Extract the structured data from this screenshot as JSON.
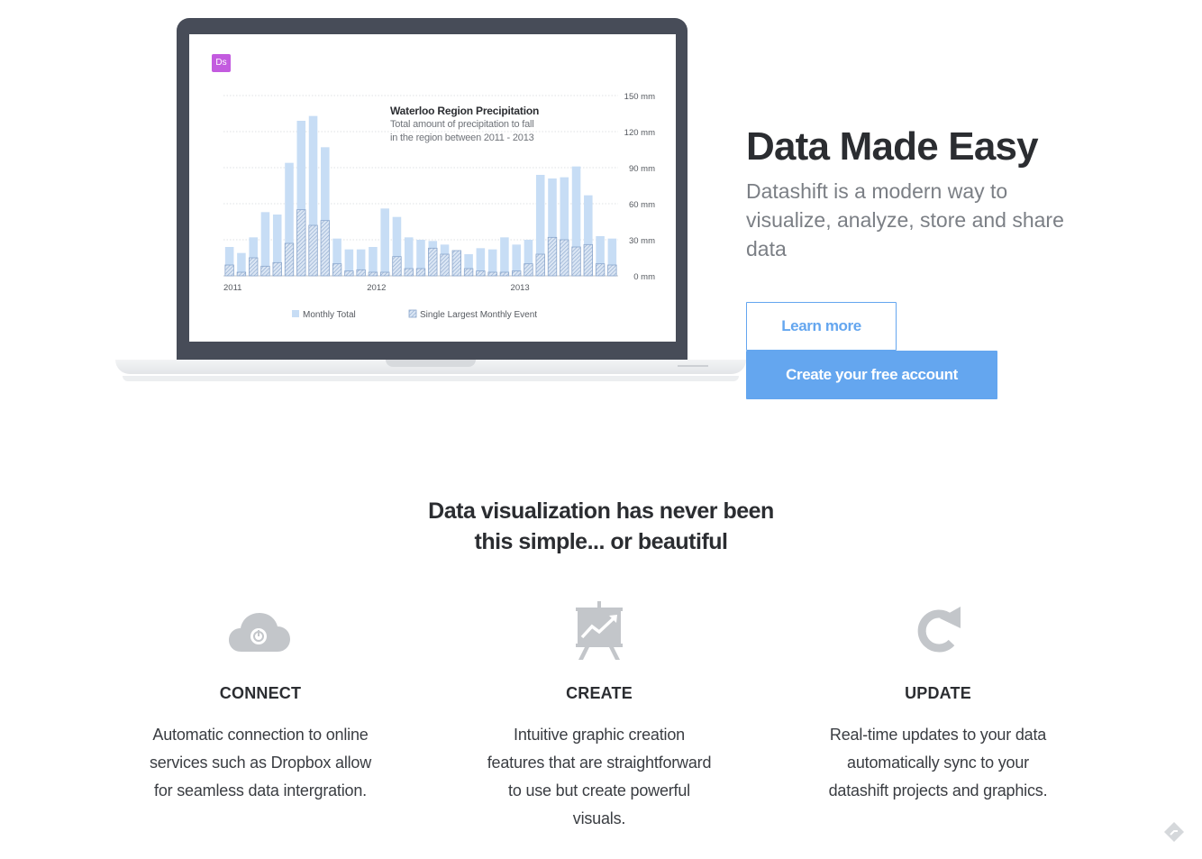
{
  "laptop": {
    "app_badge": "Ds"
  },
  "chart_data": {
    "type": "bar",
    "title": "Waterloo Region Precipitation",
    "subtitle_lines": [
      "Total amount of precipitation to fall",
      "in the region between 2011 - 2013"
    ],
    "x_tick_labels": [
      "2011",
      "2012",
      "2013"
    ],
    "y_tick_labels": [
      "150 mm",
      "120 mm",
      "90 mm",
      "60 mm",
      "30 mm",
      "0 mm"
    ],
    "ylim": [
      0,
      150
    ],
    "grid": true,
    "legend_position": "bottom",
    "colors": {
      "total": "#c7ddf5",
      "largest": "#8aa6cc"
    },
    "series": [
      {
        "name": "Monthly Total",
        "values": [
          24,
          19,
          32,
          53,
          51,
          94,
          129,
          133,
          107,
          31,
          22,
          22,
          24,
          56,
          49,
          32,
          30,
          29,
          26,
          21,
          18,
          23,
          22,
          32,
          26,
          30,
          84,
          81,
          82,
          91,
          67,
          33,
          31
        ]
      },
      {
        "name": "Single Largest Monthly Event",
        "values": [
          9,
          3,
          15,
          8,
          11,
          27,
          55,
          42,
          46,
          10,
          4,
          5,
          3,
          3,
          16,
          6,
          6,
          23,
          18,
          21,
          6,
          4,
          3,
          3,
          4,
          10,
          18,
          32,
          30,
          24,
          26,
          10,
          9
        ]
      }
    ]
  },
  "hero": {
    "title": "Data Made Easy",
    "subtitle": "Datashift is a modern way to visualize, analyze, store and share data",
    "learn_more": "Learn more",
    "create_account": "Create your free account"
  },
  "section": {
    "heading_line1": "Data visualization has never been",
    "heading_line2": "this simple... or beautiful"
  },
  "features": [
    {
      "icon": "cloud-power-icon",
      "title": "CONNECT",
      "desc": [
        "Automatic connection to online",
        "services such as Dropbox allow",
        "for seamless data intergration."
      ]
    },
    {
      "icon": "presentation-chart-icon",
      "title": "CREATE",
      "desc": [
        "Intuitive graphic creation",
        "features that are straightforward",
        "to use but create powerful",
        "visuals."
      ]
    },
    {
      "icon": "refresh-icon",
      "title": "UPDATE",
      "desc": [
        "Real-time updates to your data",
        "automatically sync to your",
        "datashift projects and graphics."
      ]
    }
  ],
  "colors": {
    "accent": "#64a6ef",
    "icon_gray": "#c3c6ca",
    "text_dark": "#2b2d31",
    "text_muted": "#7b7f85"
  }
}
